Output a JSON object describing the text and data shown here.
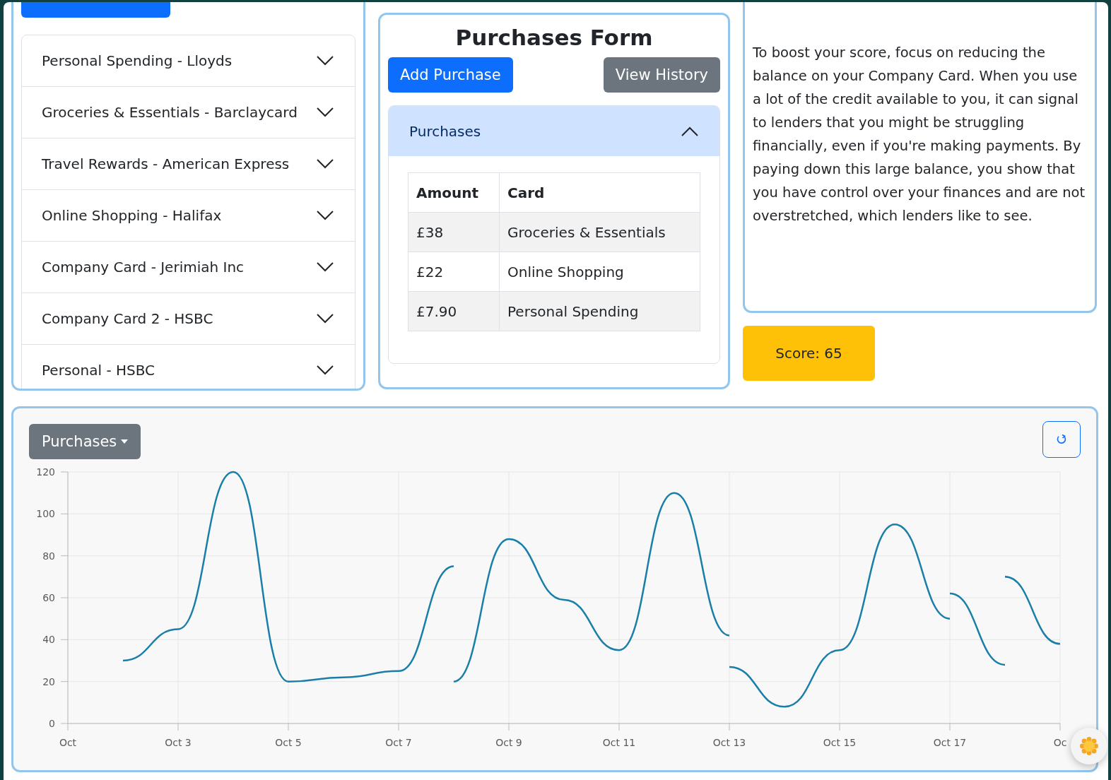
{
  "cards": [
    {
      "label": "Personal Spending - Lloyds",
      "expanded": false
    },
    {
      "label": "Groceries & Essentials - Barclaycard",
      "expanded": false
    },
    {
      "label": "Travel Rewards - American Express",
      "expanded": false
    },
    {
      "label": "Online Shopping - Halifax",
      "expanded": false
    },
    {
      "label": "Company Card - Jerimiah Inc",
      "expanded": false
    },
    {
      "label": "Company Card 2 - HSBC",
      "expanded": false
    },
    {
      "label": "Personal - HSBC",
      "expanded": false
    }
  ],
  "purchases_form": {
    "title": "Purchases Form",
    "add_button": "Add Purchase",
    "history_button": "View History",
    "accordion": {
      "title": "Purchases",
      "expanded": true
    },
    "table": {
      "columns": [
        "Amount",
        "Card"
      ],
      "rows": [
        [
          "£38",
          "Groceries & Essentials"
        ],
        [
          "£22",
          "Online Shopping"
        ],
        [
          "£7.90",
          "Personal Spending"
        ]
      ]
    }
  },
  "advice": {
    "text": "To boost your score, focus on reducing the balance on your Company Card. When you use a lot of the credit available to you, it can signal to lenders that you might be struggling financially, even if you're making payments. By paying down this large balance, you show that you have control over your finances and are not overstretched, which lenders like to see."
  },
  "score": "Score: 65",
  "chart_panel": {
    "dropdown": "Purchases",
    "chart_data": {
      "type": "line",
      "grid": true,
      "ylim": [
        0,
        120
      ],
      "categories": [
        "Oct",
        null,
        "Oct 3",
        null,
        "Oct 5",
        null,
        "Oct 7",
        null,
        "Oct 9",
        null,
        "Oct 11",
        null,
        "Oct 13",
        null,
        "Oct 15",
        null,
        "Oct 17",
        null,
        "Oc"
      ],
      "yticks": [
        0,
        20,
        40,
        60,
        80,
        100,
        120
      ],
      "series": [
        {
          "color": "#1a7fa8",
          "values": [
            null,
            30,
            45,
            120,
            20,
            22,
            25,
            75,
            null,
            null,
            null,
            null,
            null,
            null,
            null,
            null,
            null,
            null,
            null
          ]
        },
        {
          "color": "#1a7fa8",
          "values": [
            null,
            null,
            null,
            null,
            null,
            null,
            null,
            20,
            88,
            59,
            35,
            110,
            42,
            null,
            null,
            null,
            null,
            null,
            null
          ]
        },
        {
          "color": "#1a7fa8",
          "values": [
            null,
            null,
            null,
            null,
            null,
            null,
            null,
            null,
            null,
            null,
            null,
            null,
            27,
            8,
            35,
            95,
            50,
            null,
            null
          ]
        },
        {
          "color": "#1a7fa8",
          "values": [
            null,
            null,
            null,
            null,
            null,
            null,
            null,
            null,
            null,
            null,
            null,
            null,
            null,
            null,
            null,
            null,
            62,
            28,
            null
          ]
        },
        {
          "color": "#1a7fa8",
          "values": [
            null,
            null,
            null,
            null,
            null,
            null,
            null,
            null,
            null,
            null,
            null,
            null,
            null,
            null,
            null,
            null,
            null,
            70,
            38
          ]
        }
      ]
    }
  }
}
